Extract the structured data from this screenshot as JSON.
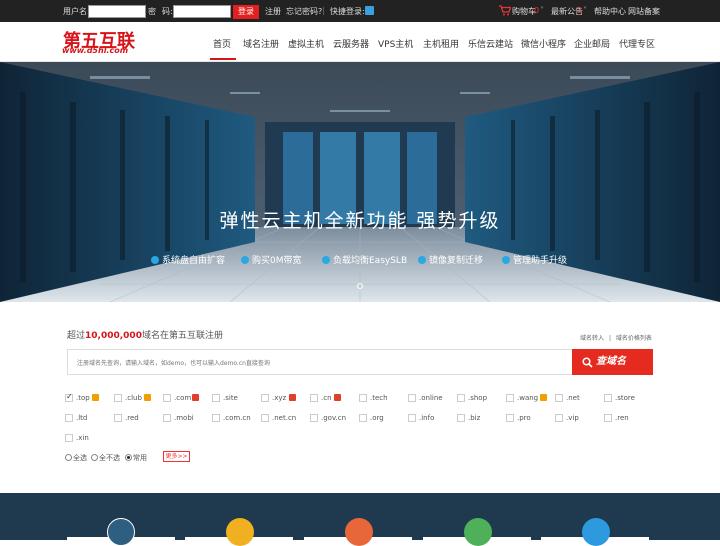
{
  "topbar": {
    "username_label": "用户名:",
    "password_label_a": "密",
    "password_label_b": "码:",
    "login": "登录",
    "register": "注册",
    "forgot": "忘记密码?",
    "separator": "|",
    "quick_login": "快捷登录:",
    "cart": "购物车",
    "cart_count": "0",
    "notice": "最新公告",
    "notice_count": "2",
    "help": "帮助中心",
    "record": "网站备案"
  },
  "logo": {
    "main": "第五互联",
    "sub": "www.d5hl.com"
  },
  "nav": [
    "首页",
    "域名注册",
    "虚拟主机",
    "云服务器",
    "VPS主机",
    "主机租用",
    "乐信云建站",
    "微信小程序",
    "企业邮局",
    "代理专区"
  ],
  "hero": {
    "title": "弹性云主机全新功能  强势升级",
    "features": [
      "系统盘自由扩容",
      "购买0M带宽",
      "负载均衡EasySLB",
      "镜像复制迁移",
      "管理助手升级"
    ]
  },
  "search": {
    "title_pre": "超过",
    "title_num": "10,000,000",
    "title_post": "域名在第五互联注册",
    "link_transfer": "域名转入",
    "link_sep": "|",
    "link_prices": "域名价格列表",
    "placeholder": "注册域名先查询，请输入域名，如demo，也可以输入demo.cn直接查询",
    "button": "查域名"
  },
  "tlds": [
    ".top",
    ".club",
    ".com",
    ".site",
    ".xyz",
    ".cn",
    ".tech",
    ".online",
    ".shop",
    ".wang",
    ".net",
    ".store",
    ".ltd",
    ".red",
    ".mobi",
    ".com.cn",
    ".net.cn",
    ".gov.cn",
    ".org",
    ".info",
    ".biz",
    ".pro",
    ".vip",
    ".ren",
    ".xin"
  ],
  "select": {
    "all": "全选",
    "none": "全不选",
    "common": "常用",
    "more": "更多>>"
  },
  "colors": {
    "brand": "#d7141a",
    "button": "#e52b20",
    "topbar": "#222222",
    "accent": "#2aa8e0"
  }
}
